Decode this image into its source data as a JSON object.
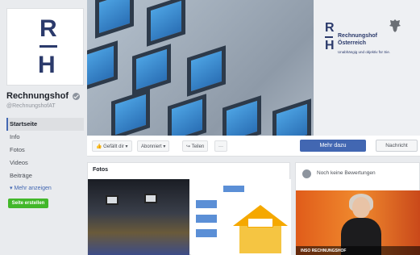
{
  "sidebar": {
    "logo": {
      "letter_top": "R",
      "letter_bottom": "H"
    },
    "page_name": "Rechnungshof",
    "handle": "@RechnungshofAT",
    "items": [
      {
        "label": "Startseite",
        "active": true
      },
      {
        "label": "Info"
      },
      {
        "label": "Fotos"
      },
      {
        "label": "Videos"
      },
      {
        "label": "Beiträge"
      }
    ],
    "more_label": "▾ Mehr anzeigen",
    "create_page_label": "Seite erstellen"
  },
  "cover": {
    "logo_r": "R",
    "logo_h": "H",
    "name_line1": "Rechnungshof",
    "name_line2": "Österreich",
    "tagline": "Unabhängig und objektiv für Sie."
  },
  "actions": {
    "like": "👍 Gefällt dir ▾",
    "subscribed": "Abonniert ▾",
    "share": "↪ Teilen",
    "more_dots": "···",
    "more_info": "Mehr dazu",
    "message": "Nachricht"
  },
  "photos": {
    "title": "Fotos"
  },
  "reviews": {
    "text": "Noch keine Bewertungen",
    "video_caption": "INSO RECHNUNGSHOF"
  },
  "colors": {
    "brand": "#2b3a6b",
    "facebook_blue": "#4267b2",
    "create_green": "#42b72a"
  }
}
